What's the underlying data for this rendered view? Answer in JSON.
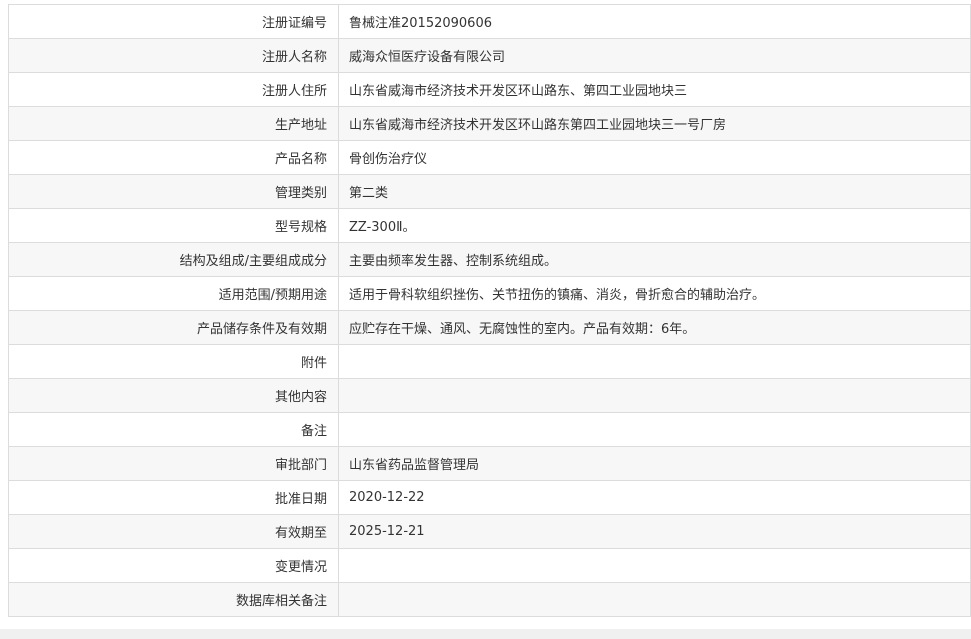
{
  "rows": [
    {
      "label": "注册证编号",
      "value": "鲁械注准20152090606"
    },
    {
      "label": "注册人名称",
      "value": "威海众恒医疗设备有限公司"
    },
    {
      "label": "注册人住所",
      "value": "山东省威海市经济技术开发区环山路东、第四工业园地块三"
    },
    {
      "label": "生产地址",
      "value": "山东省威海市经济技术开发区环山路东第四工业园地块三一号厂房"
    },
    {
      "label": "产品名称",
      "value": "骨创伤治疗仪"
    },
    {
      "label": "管理类别",
      "value": "第二类"
    },
    {
      "label": "型号规格",
      "value": "ZZ-300Ⅱ。"
    },
    {
      "label": "结构及组成/主要组成成分",
      "value": "主要由频率发生器、控制系统组成。"
    },
    {
      "label": "适用范围/预期用途",
      "value": "适用于骨科软组织挫伤、关节扭伤的镇痛、消炎，骨折愈合的辅助治疗。"
    },
    {
      "label": "产品储存条件及有效期",
      "value": "应贮存在干燥、通风、无腐蚀性的室内。产品有效期：6年。"
    },
    {
      "label": "附件",
      "value": ""
    },
    {
      "label": "其他内容",
      "value": ""
    },
    {
      "label": "备注",
      "value": ""
    },
    {
      "label": "审批部门",
      "value": "山东省药品监督管理局"
    },
    {
      "label": "批准日期",
      "value": "2020-12-22"
    },
    {
      "label": "有效期至",
      "value": "2025-12-21"
    },
    {
      "label": "变更情况",
      "value": ""
    },
    {
      "label": "数据库相关备注",
      "value": ""
    }
  ]
}
